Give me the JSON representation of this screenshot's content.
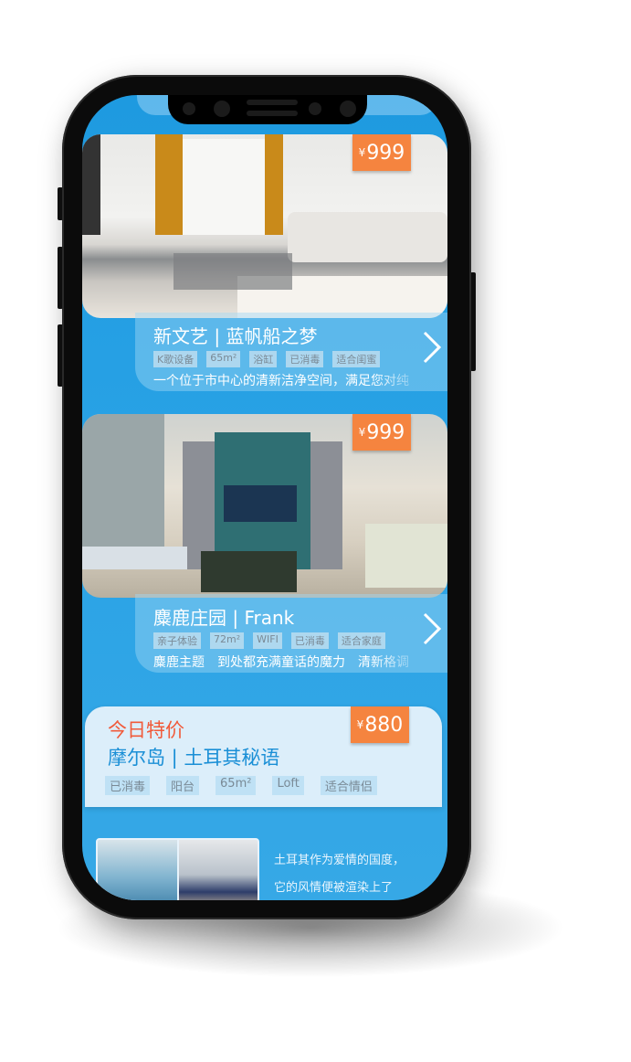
{
  "listings": [
    {
      "price_symbol": "¥",
      "price": "999",
      "title": "新文艺 | 蓝帆船之梦",
      "tags": [
        "K歌设备",
        "65m²",
        "浴缸",
        "已消毒",
        "适合闺蜜"
      ],
      "description": "一个位于市中心的清新洁净空间，满足您对纯"
    },
    {
      "price_symbol": "¥",
      "price": "999",
      "title": "麋鹿庄园 | Frank",
      "tags": [
        "亲子体验",
        "72m²",
        "WIFI",
        "已消毒",
        "适合家庭"
      ],
      "description": "麋鹿主题　到处都充满童话的魔力　清新格调"
    }
  ],
  "special": {
    "label": "今日特价",
    "price_symbol": "¥",
    "price": "880",
    "title": "摩尔岛 | 土耳其秘语",
    "tags": [
      "已消毒",
      "阳台",
      "65m²",
      "Loft",
      "适合情侣"
    ],
    "text_lines": [
      "土耳其作为爱情的国度，",
      "它的风情便被渲染上了"
    ]
  },
  "colors": {
    "background": "#1e9ae0",
    "price_tag": "#f5843f",
    "special_label": "#f15a3a",
    "special_title": "#1a8fd6"
  }
}
